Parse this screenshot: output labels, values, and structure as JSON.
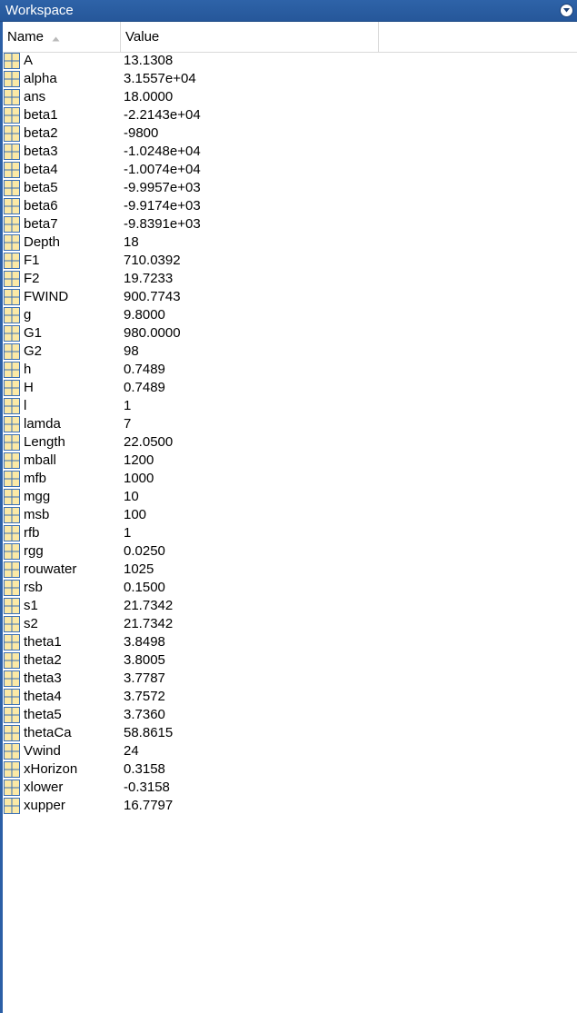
{
  "title": "Workspace",
  "menu_icon": "circle-chevron-down-icon",
  "columns": {
    "name": "Name",
    "value": "Value",
    "extra": ""
  },
  "sort_icon": "sort-ascending-icon",
  "variable_icon": "matrix-grid-icon",
  "colors": {
    "titlebar": "#2b5fa6",
    "icon_border": "#3a6fb5",
    "icon_fill": "#fbe9a6"
  },
  "variables": [
    {
      "name": "A",
      "value": "13.1308"
    },
    {
      "name": "alpha",
      "value": "3.1557e+04"
    },
    {
      "name": "ans",
      "value": "18.0000"
    },
    {
      "name": "beta1",
      "value": "-2.2143e+04"
    },
    {
      "name": "beta2",
      "value": "-9800"
    },
    {
      "name": "beta3",
      "value": "-1.0248e+04"
    },
    {
      "name": "beta4",
      "value": "-1.0074e+04"
    },
    {
      "name": "beta5",
      "value": "-9.9957e+03"
    },
    {
      "name": "beta6",
      "value": "-9.9174e+03"
    },
    {
      "name": "beta7",
      "value": "-9.8391e+03"
    },
    {
      "name": "Depth",
      "value": "18"
    },
    {
      "name": "F1",
      "value": "710.0392"
    },
    {
      "name": "F2",
      "value": "19.7233"
    },
    {
      "name": "FWIND",
      "value": "900.7743"
    },
    {
      "name": "g",
      "value": "9.8000"
    },
    {
      "name": "G1",
      "value": "980.0000"
    },
    {
      "name": "G2",
      "value": "98"
    },
    {
      "name": "h",
      "value": "0.7489"
    },
    {
      "name": "H",
      "value": "0.7489"
    },
    {
      "name": "l",
      "value": "1"
    },
    {
      "name": "lamda",
      "value": "7"
    },
    {
      "name": "Length",
      "value": "22.0500"
    },
    {
      "name": "mball",
      "value": "1200"
    },
    {
      "name": "mfb",
      "value": "1000"
    },
    {
      "name": "mgg",
      "value": "10"
    },
    {
      "name": "msb",
      "value": "100"
    },
    {
      "name": "rfb",
      "value": "1"
    },
    {
      "name": "rgg",
      "value": "0.0250"
    },
    {
      "name": "rouwater",
      "value": "1025"
    },
    {
      "name": "rsb",
      "value": "0.1500"
    },
    {
      "name": "s1",
      "value": "21.7342"
    },
    {
      "name": "s2",
      "value": "21.7342"
    },
    {
      "name": "theta1",
      "value": "3.8498"
    },
    {
      "name": "theta2",
      "value": "3.8005"
    },
    {
      "name": "theta3",
      "value": "3.7787"
    },
    {
      "name": "theta4",
      "value": "3.7572"
    },
    {
      "name": "theta5",
      "value": "3.7360"
    },
    {
      "name": "thetaCa",
      "value": "58.8615"
    },
    {
      "name": "Vwind",
      "value": "24"
    },
    {
      "name": "xHorizon",
      "value": "0.3158"
    },
    {
      "name": "xlower",
      "value": "-0.3158"
    },
    {
      "name": "xupper",
      "value": "16.7797"
    }
  ]
}
